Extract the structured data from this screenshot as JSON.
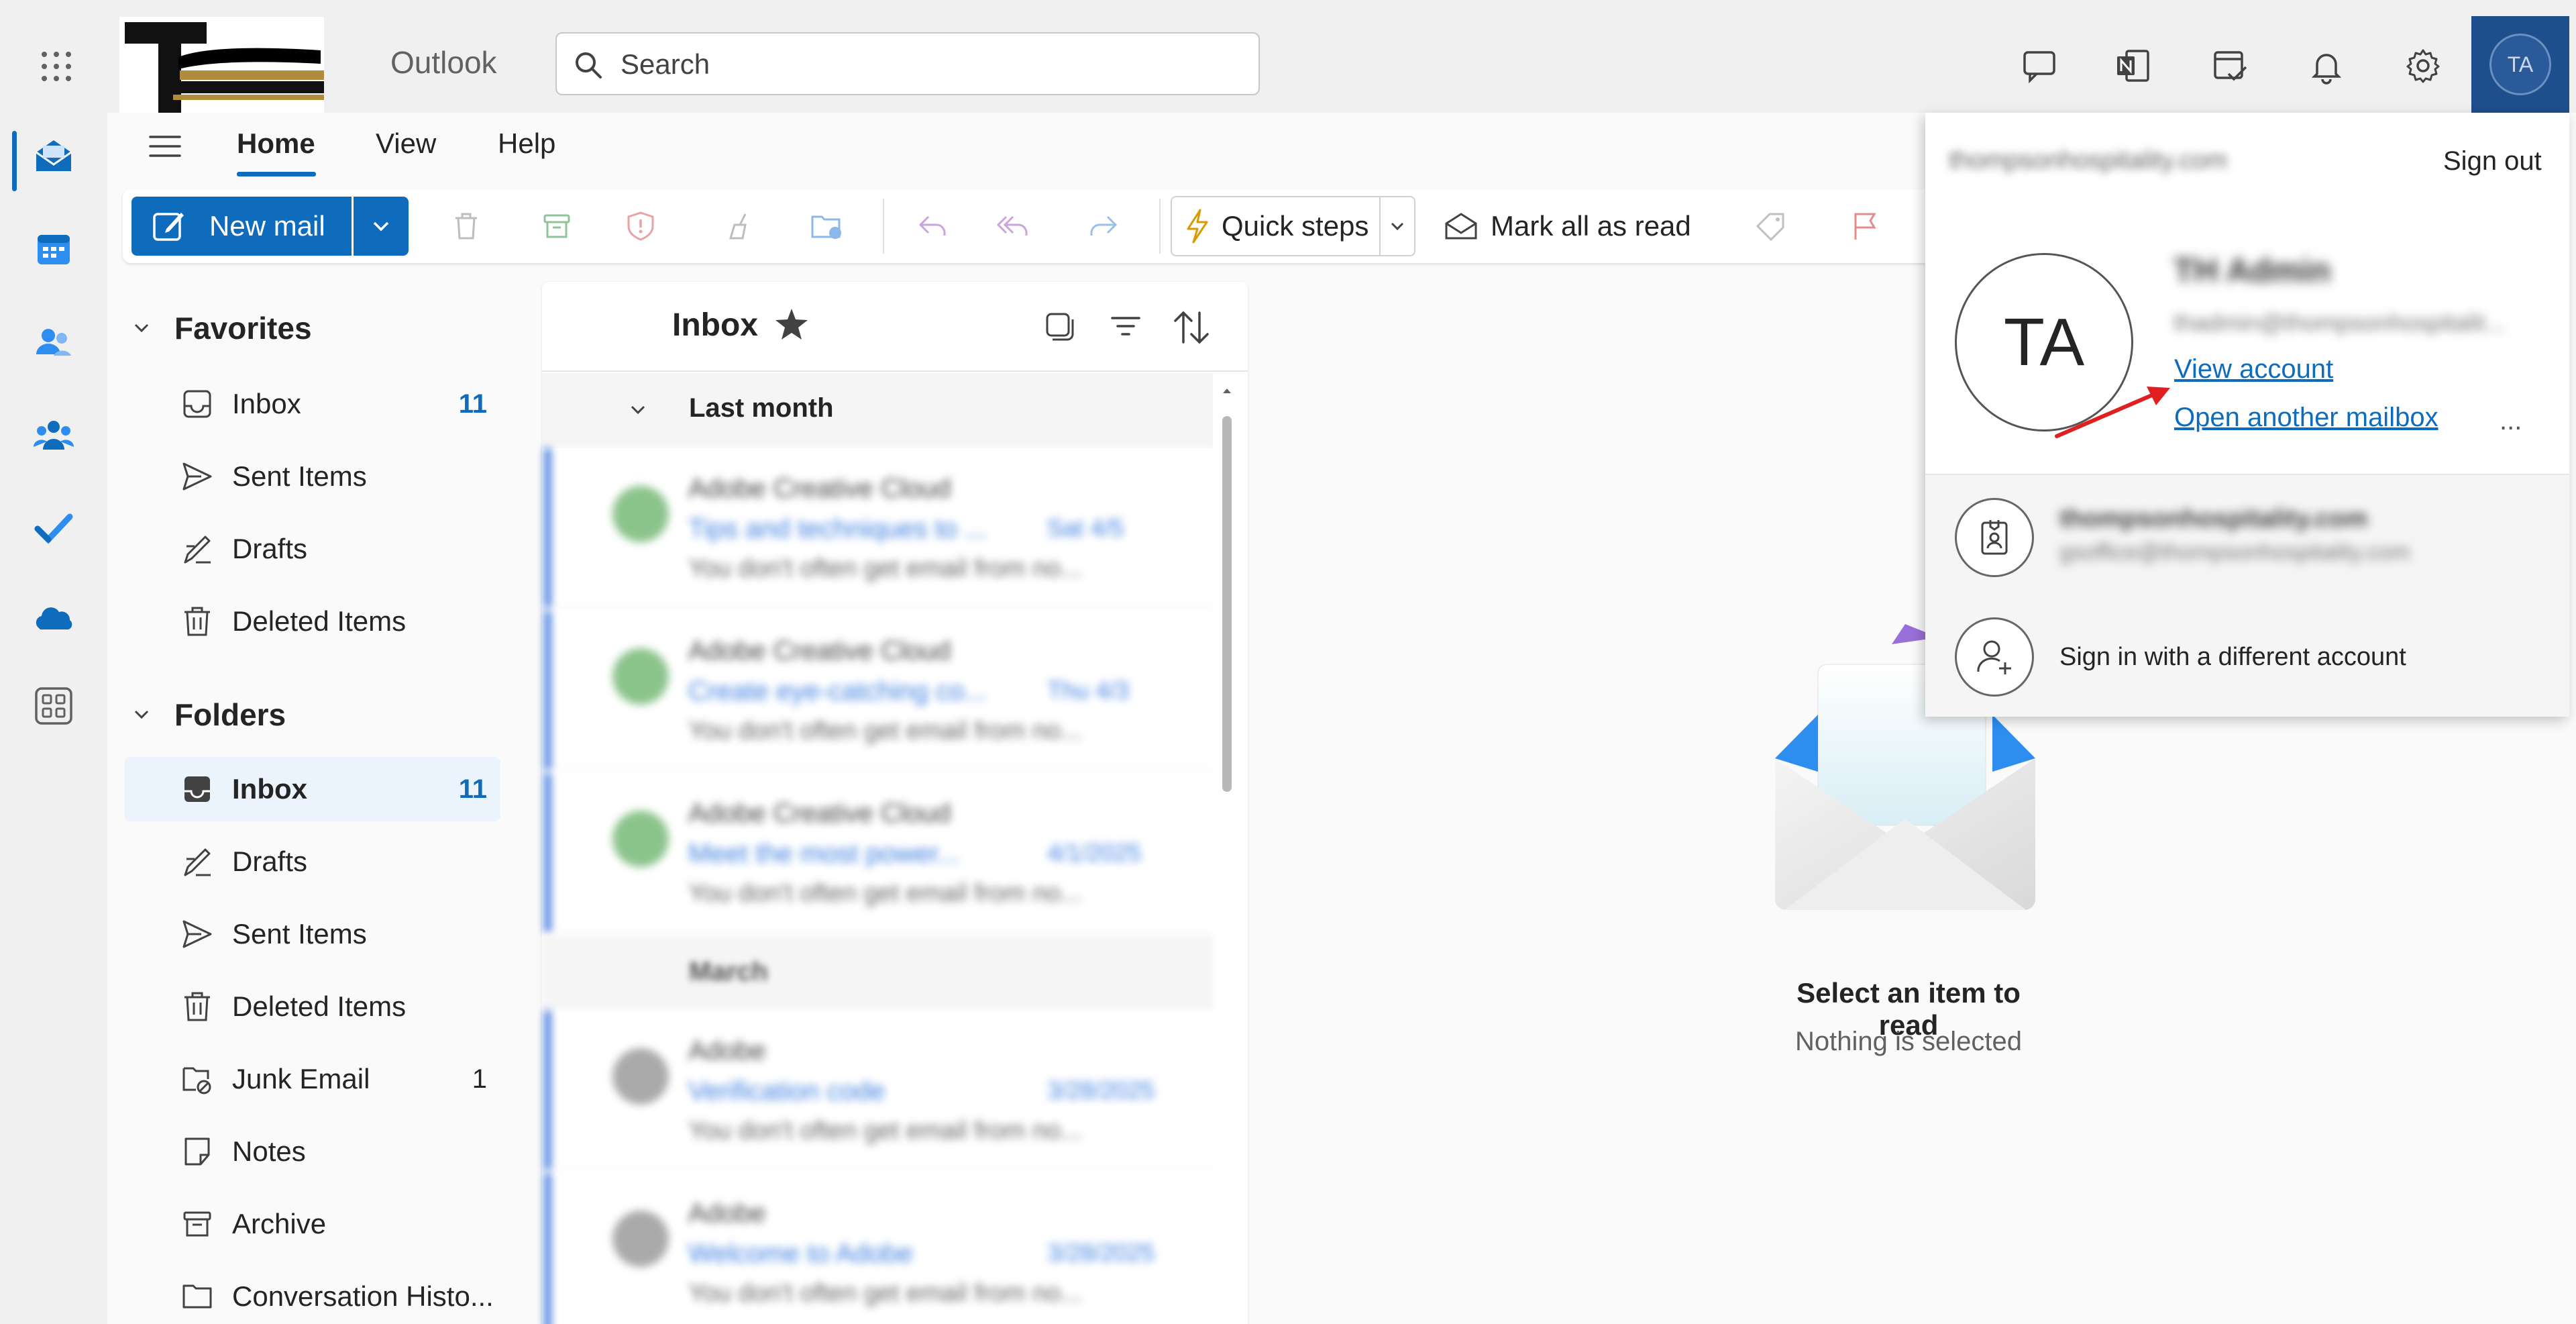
{
  "app": {
    "title": "Outlook"
  },
  "search": {
    "placeholder": "Search"
  },
  "user": {
    "initials": "TA"
  },
  "ribbon": {
    "tabs": [
      "Home",
      "View",
      "Help"
    ],
    "active_tab": "Home"
  },
  "toolbar": {
    "new_mail": "New mail",
    "quick_steps": "Quick steps",
    "mark_all_read": "Mark all as read"
  },
  "favorites": {
    "header": "Favorites",
    "items": [
      {
        "label": "Inbox",
        "count": "11"
      },
      {
        "label": "Sent Items",
        "count": ""
      },
      {
        "label": "Drafts",
        "count": ""
      },
      {
        "label": "Deleted Items",
        "count": ""
      }
    ]
  },
  "folders": {
    "header": "Folders",
    "items": [
      {
        "label": "Inbox",
        "count": "11",
        "selected": true
      },
      {
        "label": "Drafts",
        "count": ""
      },
      {
        "label": "Sent Items",
        "count": ""
      },
      {
        "label": "Deleted Items",
        "count": ""
      },
      {
        "label": "Junk Email",
        "count": "1"
      },
      {
        "label": "Notes",
        "count": ""
      },
      {
        "label": "Archive",
        "count": ""
      },
      {
        "label": "Conversation Histo...",
        "count": ""
      }
    ]
  },
  "message_list": {
    "title": "Inbox",
    "group_label": "Last month",
    "group_label_2": "March",
    "messages": [
      {
        "sender": "Adobe Creative Cloud",
        "subject": "Tips and techniques to ...",
        "date": "Sat 4/5",
        "preview": "You don't often get email from no..."
      },
      {
        "sender": "Adobe Creative Cloud",
        "subject": "Create eye-catching co...",
        "date": "Thu 4/3",
        "preview": "You don't often get email from no..."
      },
      {
        "sender": "Adobe Creative Cloud",
        "subject": "Meet the most power...",
        "date": "4/1/2025",
        "preview": "You don't often get email from no..."
      },
      {
        "sender": "Adobe",
        "subject": "Verification code",
        "date": "3/28/2025",
        "preview": "You don't often get email from no..."
      },
      {
        "sender": "Adobe",
        "subject": "Welcome to Adobe",
        "date": "3/28/2025",
        "preview": "You don't often get email from no..."
      }
    ]
  },
  "reading_pane": {
    "title": "Select an item to read",
    "subtitle": "Nothing is selected"
  },
  "account_popup": {
    "domain": "thompsonhospitality.com",
    "sign_out": "Sign out",
    "avatar_initials": "TA",
    "name": "TH Admin",
    "email": "thadmin@thompsonhospitalit...",
    "view_account": "View account",
    "open_another": "Open another mailbox",
    "more": "...",
    "other_account_domain": "thompsonhospitality.com",
    "other_account_email": "gsoffice@thompsonhospitality.com",
    "sign_in_different": "Sign in with a different account"
  },
  "colors": {
    "accent": "#0f6cbd",
    "unread_bar": "#2c6bd8",
    "avatar_bg": "#1f4e8c"
  }
}
